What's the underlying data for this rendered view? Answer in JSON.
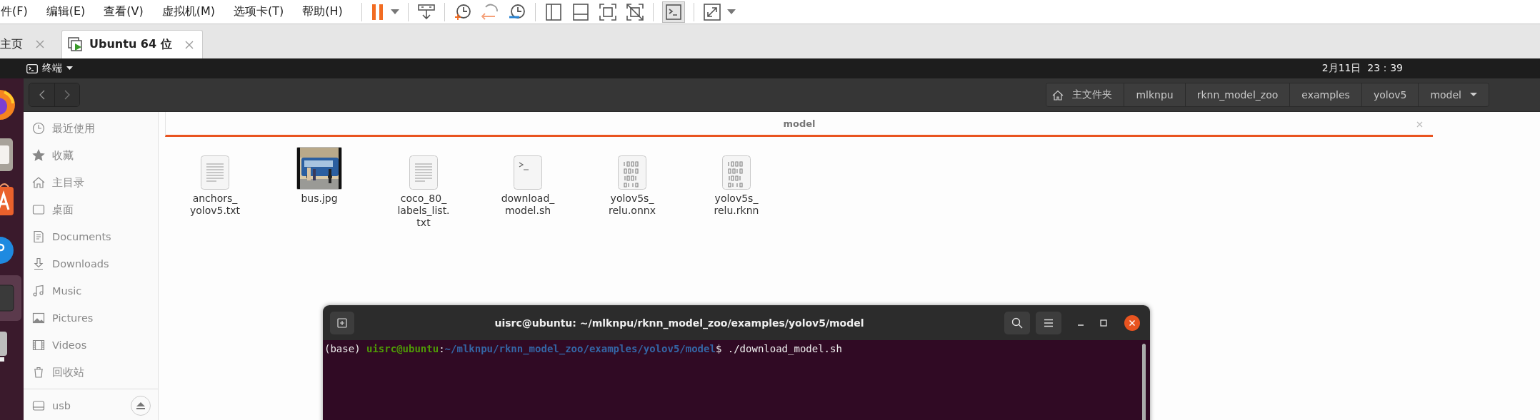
{
  "menu_bar": {
    "items": [
      "件(F)",
      "编辑(E)",
      "查看(V)",
      "虚拟机(M)",
      "选项卡(T)",
      "帮助(H)"
    ]
  },
  "toolbar": {
    "console_view_on": true
  },
  "tabs": [
    {
      "label": "主页",
      "selected": false
    },
    {
      "label": "Ubuntu 64 位",
      "selected": true
    }
  ],
  "top_bar": {
    "app_menu": "终端",
    "clock": "2月11日  23：39"
  },
  "file_manager": {
    "breadcrumbs": [
      {
        "label": "主文件夹",
        "kind": "home"
      },
      {
        "label": "mlknpu",
        "kind": "folder"
      },
      {
        "label": "rknn_model_zoo",
        "kind": "folder"
      },
      {
        "label": "examples",
        "kind": "folder"
      },
      {
        "label": "yolov5",
        "kind": "folder"
      },
      {
        "label": "model",
        "kind": "current"
      }
    ],
    "sidebar": {
      "places": [
        {
          "label": "最近使用",
          "kind": "recent"
        },
        {
          "label": "收藏",
          "kind": "starred"
        },
        {
          "label": "主目录",
          "kind": "home"
        },
        {
          "label": "桌面",
          "kind": "desktop"
        },
        {
          "label": "Documents",
          "kind": "documents"
        },
        {
          "label": "Downloads",
          "kind": "downloads"
        },
        {
          "label": "Music",
          "kind": "music"
        },
        {
          "label": "Pictures",
          "kind": "pictures"
        },
        {
          "label": "Videos",
          "kind": "videos"
        },
        {
          "label": "回收站",
          "kind": "trash"
        }
      ],
      "devices": [
        {
          "label": "usb"
        }
      ]
    },
    "view_tab": "model",
    "files": [
      {
        "name_lines": [
          "anchors_",
          "yolov5.txt"
        ],
        "kind": "text"
      },
      {
        "name_lines": [
          "bus.jpg"
        ],
        "kind": "picture"
      },
      {
        "name_lines": [
          "coco_80_",
          "labels_list.",
          "txt"
        ],
        "kind": "text"
      },
      {
        "name_lines": [
          "download_",
          "model.sh"
        ],
        "kind": "script"
      },
      {
        "name_lines": [
          "yolov5s_",
          "relu.onnx"
        ],
        "kind": "binary"
      },
      {
        "name_lines": [
          "yolov5s_",
          "relu.rknn"
        ],
        "kind": "binary"
      }
    ]
  },
  "terminal": {
    "title": "uisrc@ubuntu: ~/mlknpu/rknn_model_zoo/examples/yolov5/model",
    "lines": [
      {
        "env": "(base) ",
        "user_host": "uisrc@ubuntu",
        "separator": ":",
        "path": "~/mlknpu/rknn_model_zoo/examples/yolov5/model",
        "symbol": "$ ",
        "command": "./download_model.sh"
      }
    ]
  }
}
